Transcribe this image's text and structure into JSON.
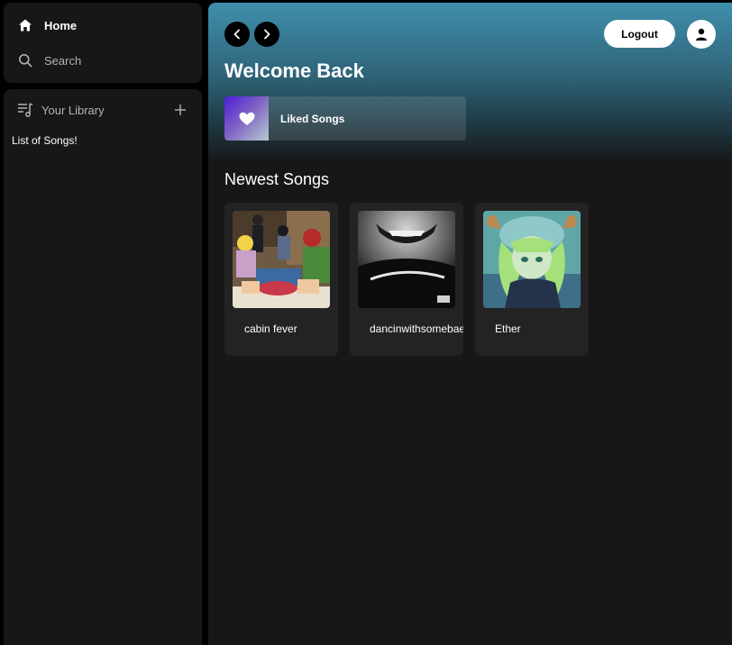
{
  "sidebar": {
    "nav": [
      {
        "label": "Home",
        "icon": "home-icon"
      },
      {
        "label": "Search",
        "icon": "search-icon"
      }
    ],
    "library": {
      "label": "Your Library",
      "icon": "library-icon",
      "add_icon": "plus-icon",
      "empty_text": "List of Songs!"
    }
  },
  "header": {
    "back_icon": "chevron-left-icon",
    "forward_icon": "chevron-right-icon",
    "logout_label": "Logout",
    "user_icon": "user-icon",
    "welcome": "Welcome Back",
    "liked": {
      "label": "Liked Songs",
      "icon": "heart-icon"
    }
  },
  "newest": {
    "title": "Newest Songs",
    "songs": [
      {
        "title": "cabin fever"
      },
      {
        "title": "dancinwithsomebae"
      },
      {
        "title": "Ether"
      }
    ]
  },
  "colors": {
    "accent_gradient_top": "#3f8fad",
    "background": "#171717",
    "liked_gradient": [
      "#4b1fd8",
      "#b6ccd0"
    ]
  }
}
